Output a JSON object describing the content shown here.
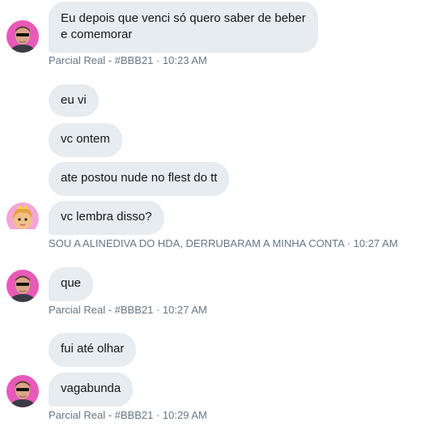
{
  "messages": [
    {
      "text": "Eu depois que venci só quero saber de beber e comemorar"
    },
    {
      "text": "eu vi"
    },
    {
      "text": "vc ontem"
    },
    {
      "text": "ate postou nude no flest do tt"
    },
    {
      "text": "vc lembra disso?"
    },
    {
      "text": "que"
    },
    {
      "text": "fui até olhar"
    },
    {
      "text": "vagabunda"
    }
  ],
  "meta": [
    {
      "text": "Parcial Real - #BBB21 · 10:23 AM"
    },
    {
      "text": "SOU A ALINEDIVA DO HDA, DERRUBARAM A MINHA CONTA · 10:27 AM"
    },
    {
      "text": "Parcial Real - #BBB21 · 10:27 AM"
    },
    {
      "text": "Parcial Real - #BBB21 · 10:29 AM"
    }
  ],
  "avatars": {
    "parcial_real": {
      "icon": "man-with-sunglasses-avatar",
      "bg": "#e85ab8"
    },
    "alinediva": {
      "icon": "cartoon-girl-avatar",
      "bg": "#f3a6d6"
    }
  },
  "colors": {
    "bubble": "#e6ecf0",
    "meta": "#657786",
    "text": "#14171a"
  }
}
